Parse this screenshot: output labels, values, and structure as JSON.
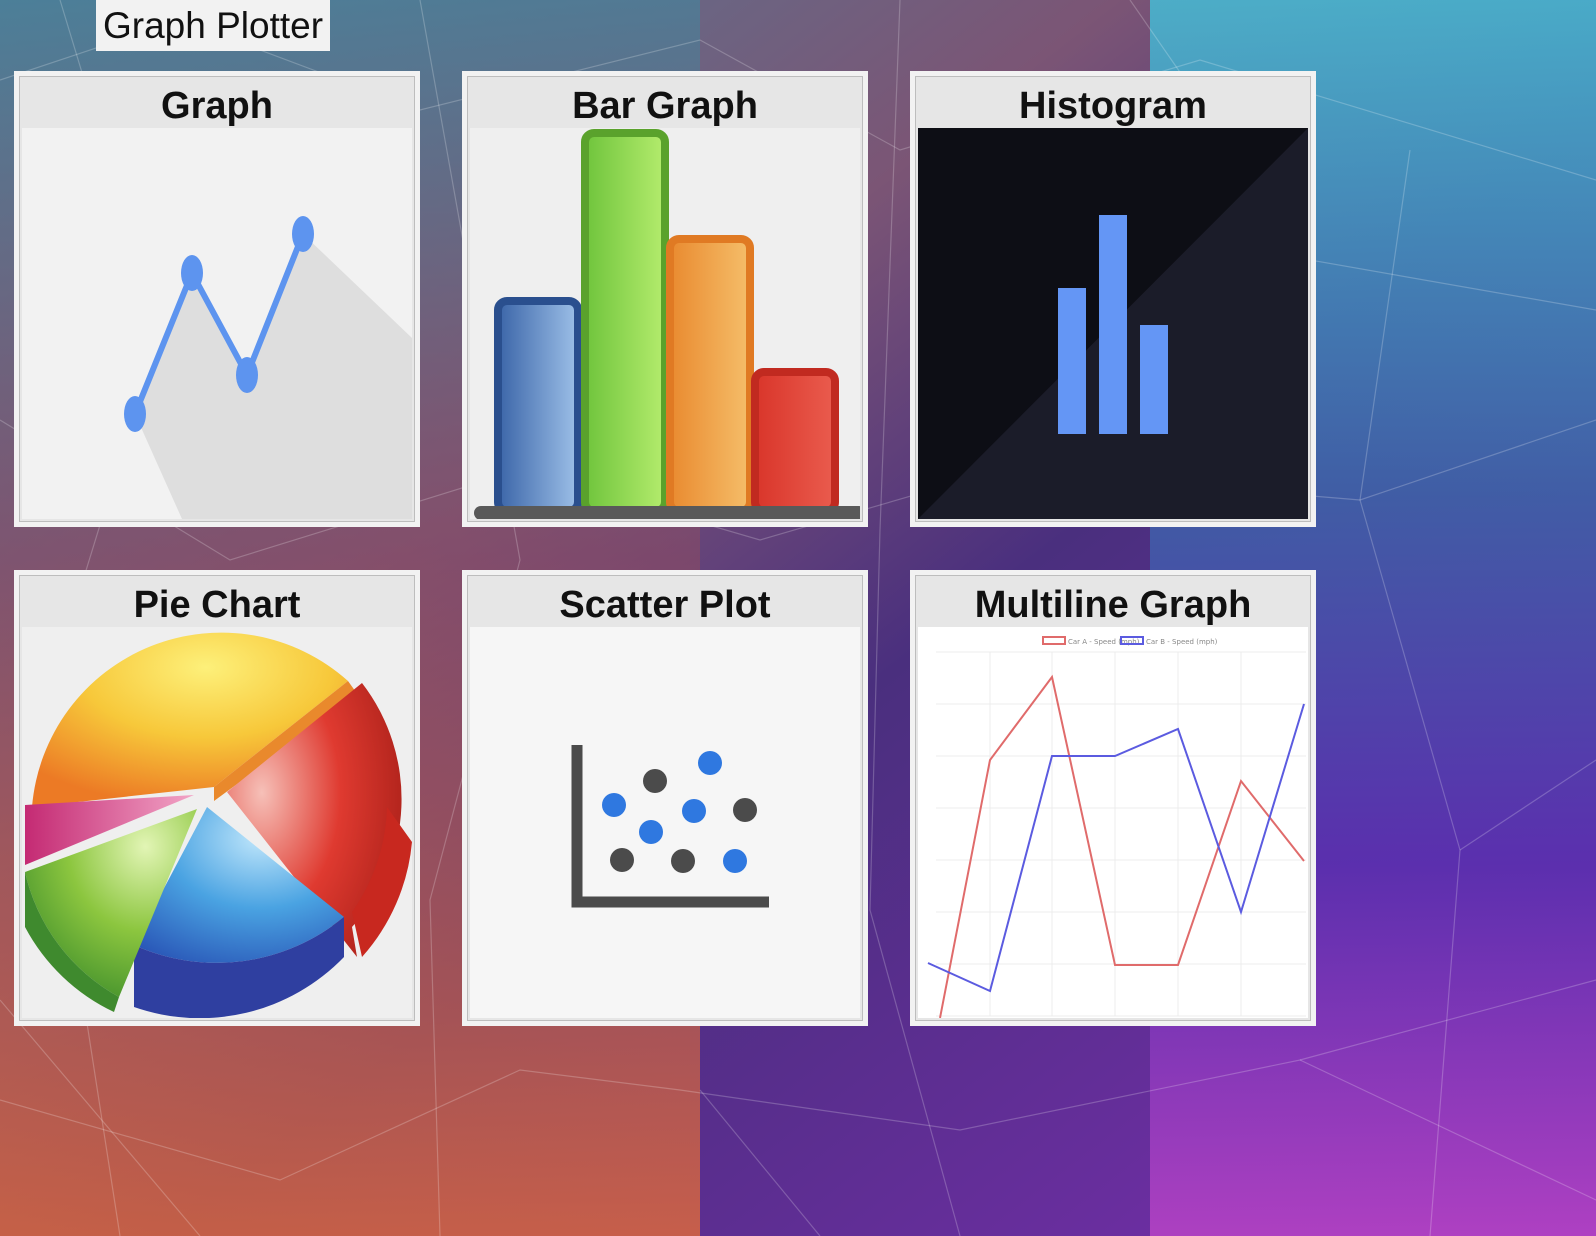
{
  "app": {
    "title": "Graph Plotter"
  },
  "cards": [
    {
      "label": "Graph",
      "icon": "line-graph-icon"
    },
    {
      "label": "Bar Graph",
      "icon": "bar-graph-icon"
    },
    {
      "label": "Histogram",
      "icon": "histogram-icon"
    },
    {
      "label": "Pie Chart",
      "icon": "pie-chart-icon"
    },
    {
      "label": "Scatter Plot",
      "icon": "scatter-plot-icon"
    },
    {
      "label": "Multiline Graph",
      "icon": "multiline-graph-icon"
    }
  ],
  "multiline_preview": {
    "legend": [
      "Car A - Speed (mph)",
      "Car B - Speed (mph)"
    ],
    "colors": {
      "series_a": "#e06b6b",
      "series_b": "#5b5be0"
    }
  }
}
